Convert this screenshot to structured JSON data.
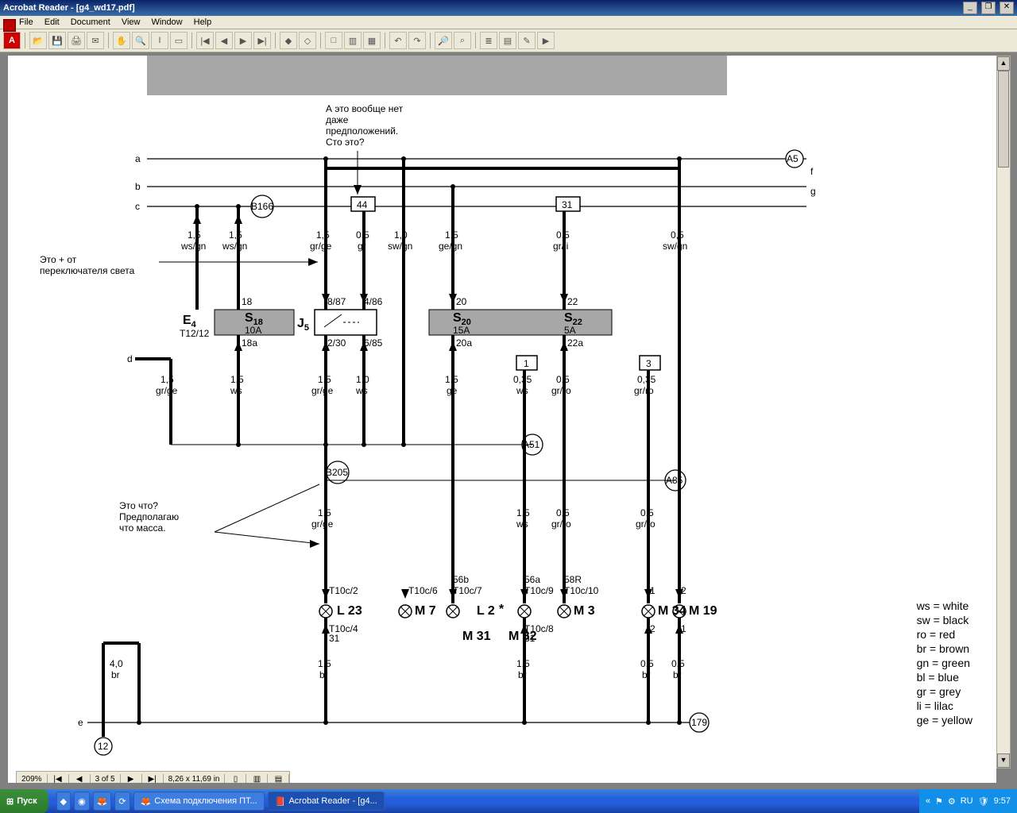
{
  "window": {
    "title": "Acrobat Reader - [g4_wd17.pdf]",
    "win_buttons": [
      "_",
      "❐",
      "✕"
    ]
  },
  "menu": [
    "File",
    "Edit",
    "Document",
    "View",
    "Window",
    "Help"
  ],
  "pager": {
    "zoom": "209%",
    "page": "3 of 5",
    "size": "8,26 x 11,69 in"
  },
  "taskbar": {
    "start": "Пуск",
    "tasks": [
      "Схема подключения ПТ...",
      "Acrobat Reader - [g4..."
    ],
    "tray": {
      "lang": "RU",
      "clock": "9:57"
    }
  },
  "diagram": {
    "busLabels": [
      "a",
      "b",
      "c",
      "d",
      "e",
      "f",
      "g"
    ],
    "connectors": {
      "A5": "A5",
      "B166": "B166",
      "A51": "A51",
      "B205": "B205",
      "A85": "A85",
      "n179": "179",
      "n12": "12",
      "box44": "44",
      "box31": "31",
      "box1": "1",
      "box3": "3"
    },
    "components": {
      "E4": {
        "label": "E",
        "sub": "4",
        "terminal": "T12/12"
      },
      "S18": {
        "label": "S",
        "sub": "18",
        "rating": "10A"
      },
      "J5": {
        "label": "J",
        "sub": "5"
      },
      "S20": {
        "label": "S",
        "sub": "20",
        "rating": "15A"
      },
      "S22": {
        "label": "S",
        "sub": "22",
        "rating": "5A"
      }
    },
    "wires": {
      "c1": {
        "size": "1,5",
        "color": "ws/gn"
      },
      "c2": {
        "size": "1,5",
        "color": "ws/gn"
      },
      "c3": {
        "size": "1,5",
        "color": "gr/ge"
      },
      "c4": {
        "size": "0,5",
        "color": "gr"
      },
      "c5": {
        "size": "1,0",
        "color": "sw/gn"
      },
      "c6": {
        "size": "1,5",
        "color": "ge/gn"
      },
      "c7": {
        "size": "0,5",
        "color": "gr/li"
      },
      "c8": {
        "size": "0,5",
        "color": "sw/gn"
      },
      "m1": {
        "size": "1,5",
        "color": "gr/ge"
      },
      "m2": {
        "size": "1,5",
        "color": "ws"
      },
      "m3": {
        "size": "1,5",
        "color": "gr/ge"
      },
      "m4": {
        "size": "1,0",
        "color": "ws"
      },
      "m5": {
        "size": "1,5",
        "color": "ge"
      },
      "m6": {
        "size": "0,35",
        "color": "ws"
      },
      "m7": {
        "size": "0,5",
        "color": "gr/ro"
      },
      "m8": {
        "size": "0,35",
        "color": "gr/ro"
      },
      "l1": {
        "size": "1,5",
        "color": "gr/ge"
      },
      "l5": {
        "size": "1,5",
        "color": "ws"
      },
      "l6": {
        "size": "0,5",
        "color": "gr/ro"
      },
      "l7": {
        "size": "0,5",
        "color": "gr/ro"
      },
      "b1": {
        "size": "4,0",
        "color": "br"
      },
      "b2": {
        "size": "1,5",
        "color": "br"
      },
      "b3": {
        "size": "1,5",
        "color": "br"
      },
      "b4": {
        "size": "0,5",
        "color": "br"
      },
      "b5": {
        "size": "0,5",
        "color": "br"
      }
    },
    "pins": {
      "p18": "18",
      "p18a": "18a",
      "p887": "8/87",
      "p486": "4/86",
      "p230": "2/30",
      "p685": "6/85",
      "p20": "20",
      "p20a": "20a",
      "p22": "22",
      "p22a": "22a",
      "t2": "T10c/2",
      "t4": "T10c/4",
      "t431": "31",
      "t6": "T10c/6",
      "t7": "T10c/7",
      "t56b": "56b",
      "t9": "T10c/9",
      "t56a": "56a",
      "t8": "T10c/8",
      "t831": "31",
      "t10": "T10c/10",
      "t58R": "58R",
      "p1t": "1",
      "p2t": "2",
      "p1b": "1",
      "p2b": "2"
    },
    "lamps": {
      "L23": "L 23",
      "M7": "M 7",
      "L2": "L 2",
      "M31": "M 31",
      "M32": "M 32",
      "M3": "M 3",
      "M34": "M 34",
      "M19": "M 19",
      "star": "*"
    },
    "annotations": {
      "a1": "А это вообще нет\nдаже\nпредположений.\nСто это?",
      "a2": "Это + от\nпереключателя света",
      "a3": "Это что?\nПредполагаю\nчто масса."
    },
    "legend": [
      "ws = white",
      "sw = black",
      "ro  = red",
      "br  = brown",
      "gn = green",
      "bl  = blue",
      "gr  = grey",
      "li   = lilac",
      "ge = yellow"
    ]
  }
}
